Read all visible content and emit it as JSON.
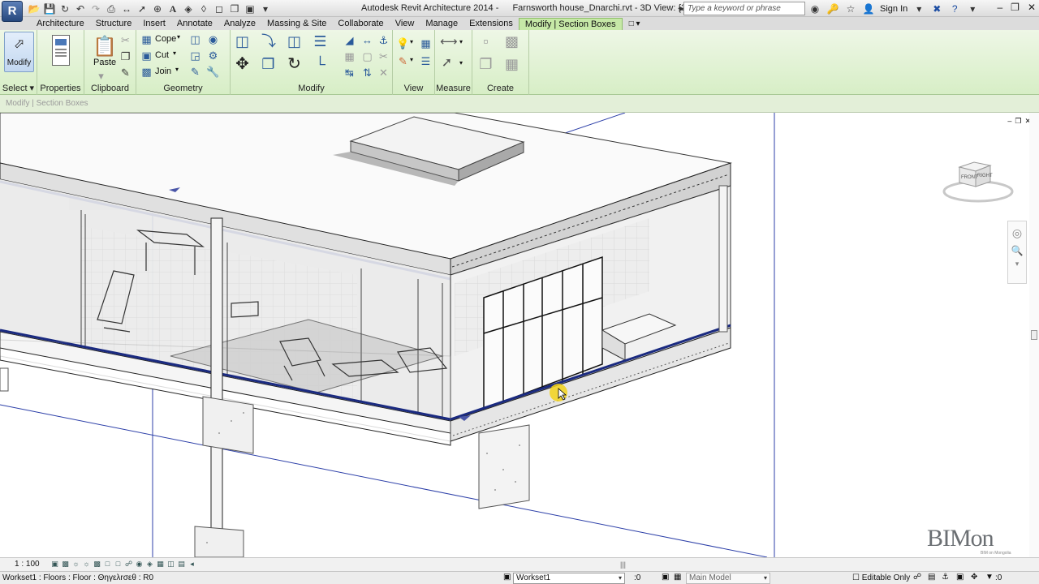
{
  "app": {
    "menu_letter": "R",
    "title_app": "Autodesk Revit Architecture 2014 -",
    "title_file": "Farnsworth house_Dnarchi.rvt - 3D View: {3D}",
    "search_placeholder": "Type a keyword or phrase",
    "sign_in": "Sign In"
  },
  "tabs": [
    "Architecture",
    "Structure",
    "Insert",
    "Annotate",
    "Analyze",
    "Massing & Site",
    "Collaborate",
    "View",
    "Manage",
    "Extensions",
    "Modify | Section Boxes"
  ],
  "active_tab": "Modify | Section Boxes",
  "ribbon": {
    "modify_label": "Modify",
    "panels": {
      "select": "Select",
      "properties": "Properties",
      "clipboard": "Clipboard",
      "geometry": "Geometry",
      "modify": "Modify",
      "view": "View",
      "measure": "Measure",
      "create": "Create"
    },
    "clipboard": {
      "paste": "Paste"
    },
    "geometry": {
      "cope": "Cope",
      "cut": "Cut",
      "join": "Join"
    }
  },
  "context_bar": "Modify | Section Boxes",
  "view_control": {
    "scale": "1 : 100"
  },
  "status": {
    "text": "Workset1 : Floors : Floor : Θηγελrσεθ : R0",
    "workset": "Workset1",
    "coord": ":0",
    "model": "Main Model",
    "editable": "Editable Only",
    "filter": ":0"
  },
  "watermark": {
    "brand": "BIMon",
    "tagline": "BIM on Mongolia"
  },
  "viewcube": {
    "front": "FRONT",
    "right": "RIGHT"
  },
  "colors": {
    "ribbon_accent": "#c6e8a7",
    "section_box": "#1f3a93",
    "title_bg": "#e4e4e4"
  }
}
